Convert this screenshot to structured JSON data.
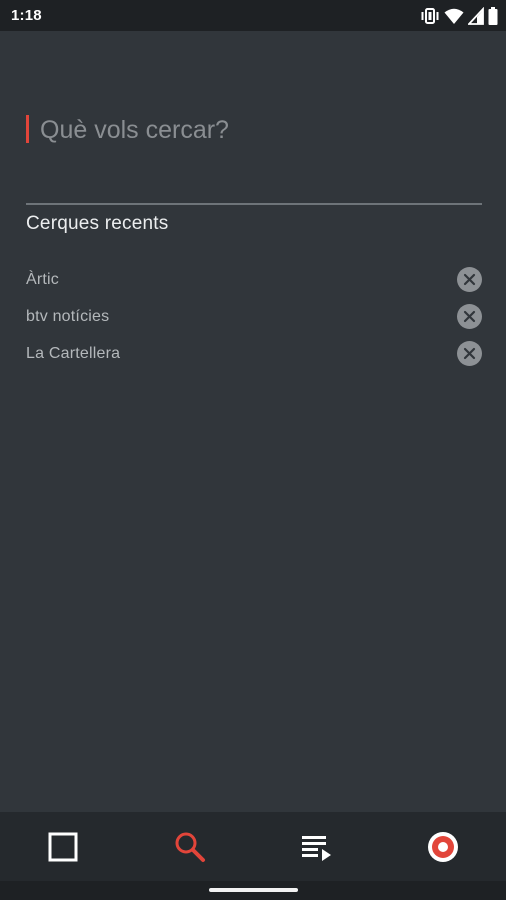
{
  "status_bar": {
    "time": "1:18",
    "icons": [
      "vibrate-icon",
      "wifi-icon",
      "signal-icon",
      "battery-icon"
    ]
  },
  "search": {
    "placeholder": "Què vols cercar?",
    "value": ""
  },
  "recent": {
    "title": "Cerques recents",
    "items": [
      {
        "label": "Àrtic"
      },
      {
        "label": "btv notícies"
      },
      {
        "label": "La Cartellera"
      }
    ]
  },
  "nav": {
    "items": [
      {
        "icon": "square-icon",
        "active": false
      },
      {
        "icon": "search-icon",
        "active": true
      },
      {
        "icon": "playlist-icon",
        "active": false
      },
      {
        "icon": "live-record-icon",
        "active": false
      }
    ]
  },
  "colors": {
    "background": "#31363b",
    "accent": "#e2453a",
    "nav_background": "#25292d",
    "status_background": "#1e2124"
  }
}
